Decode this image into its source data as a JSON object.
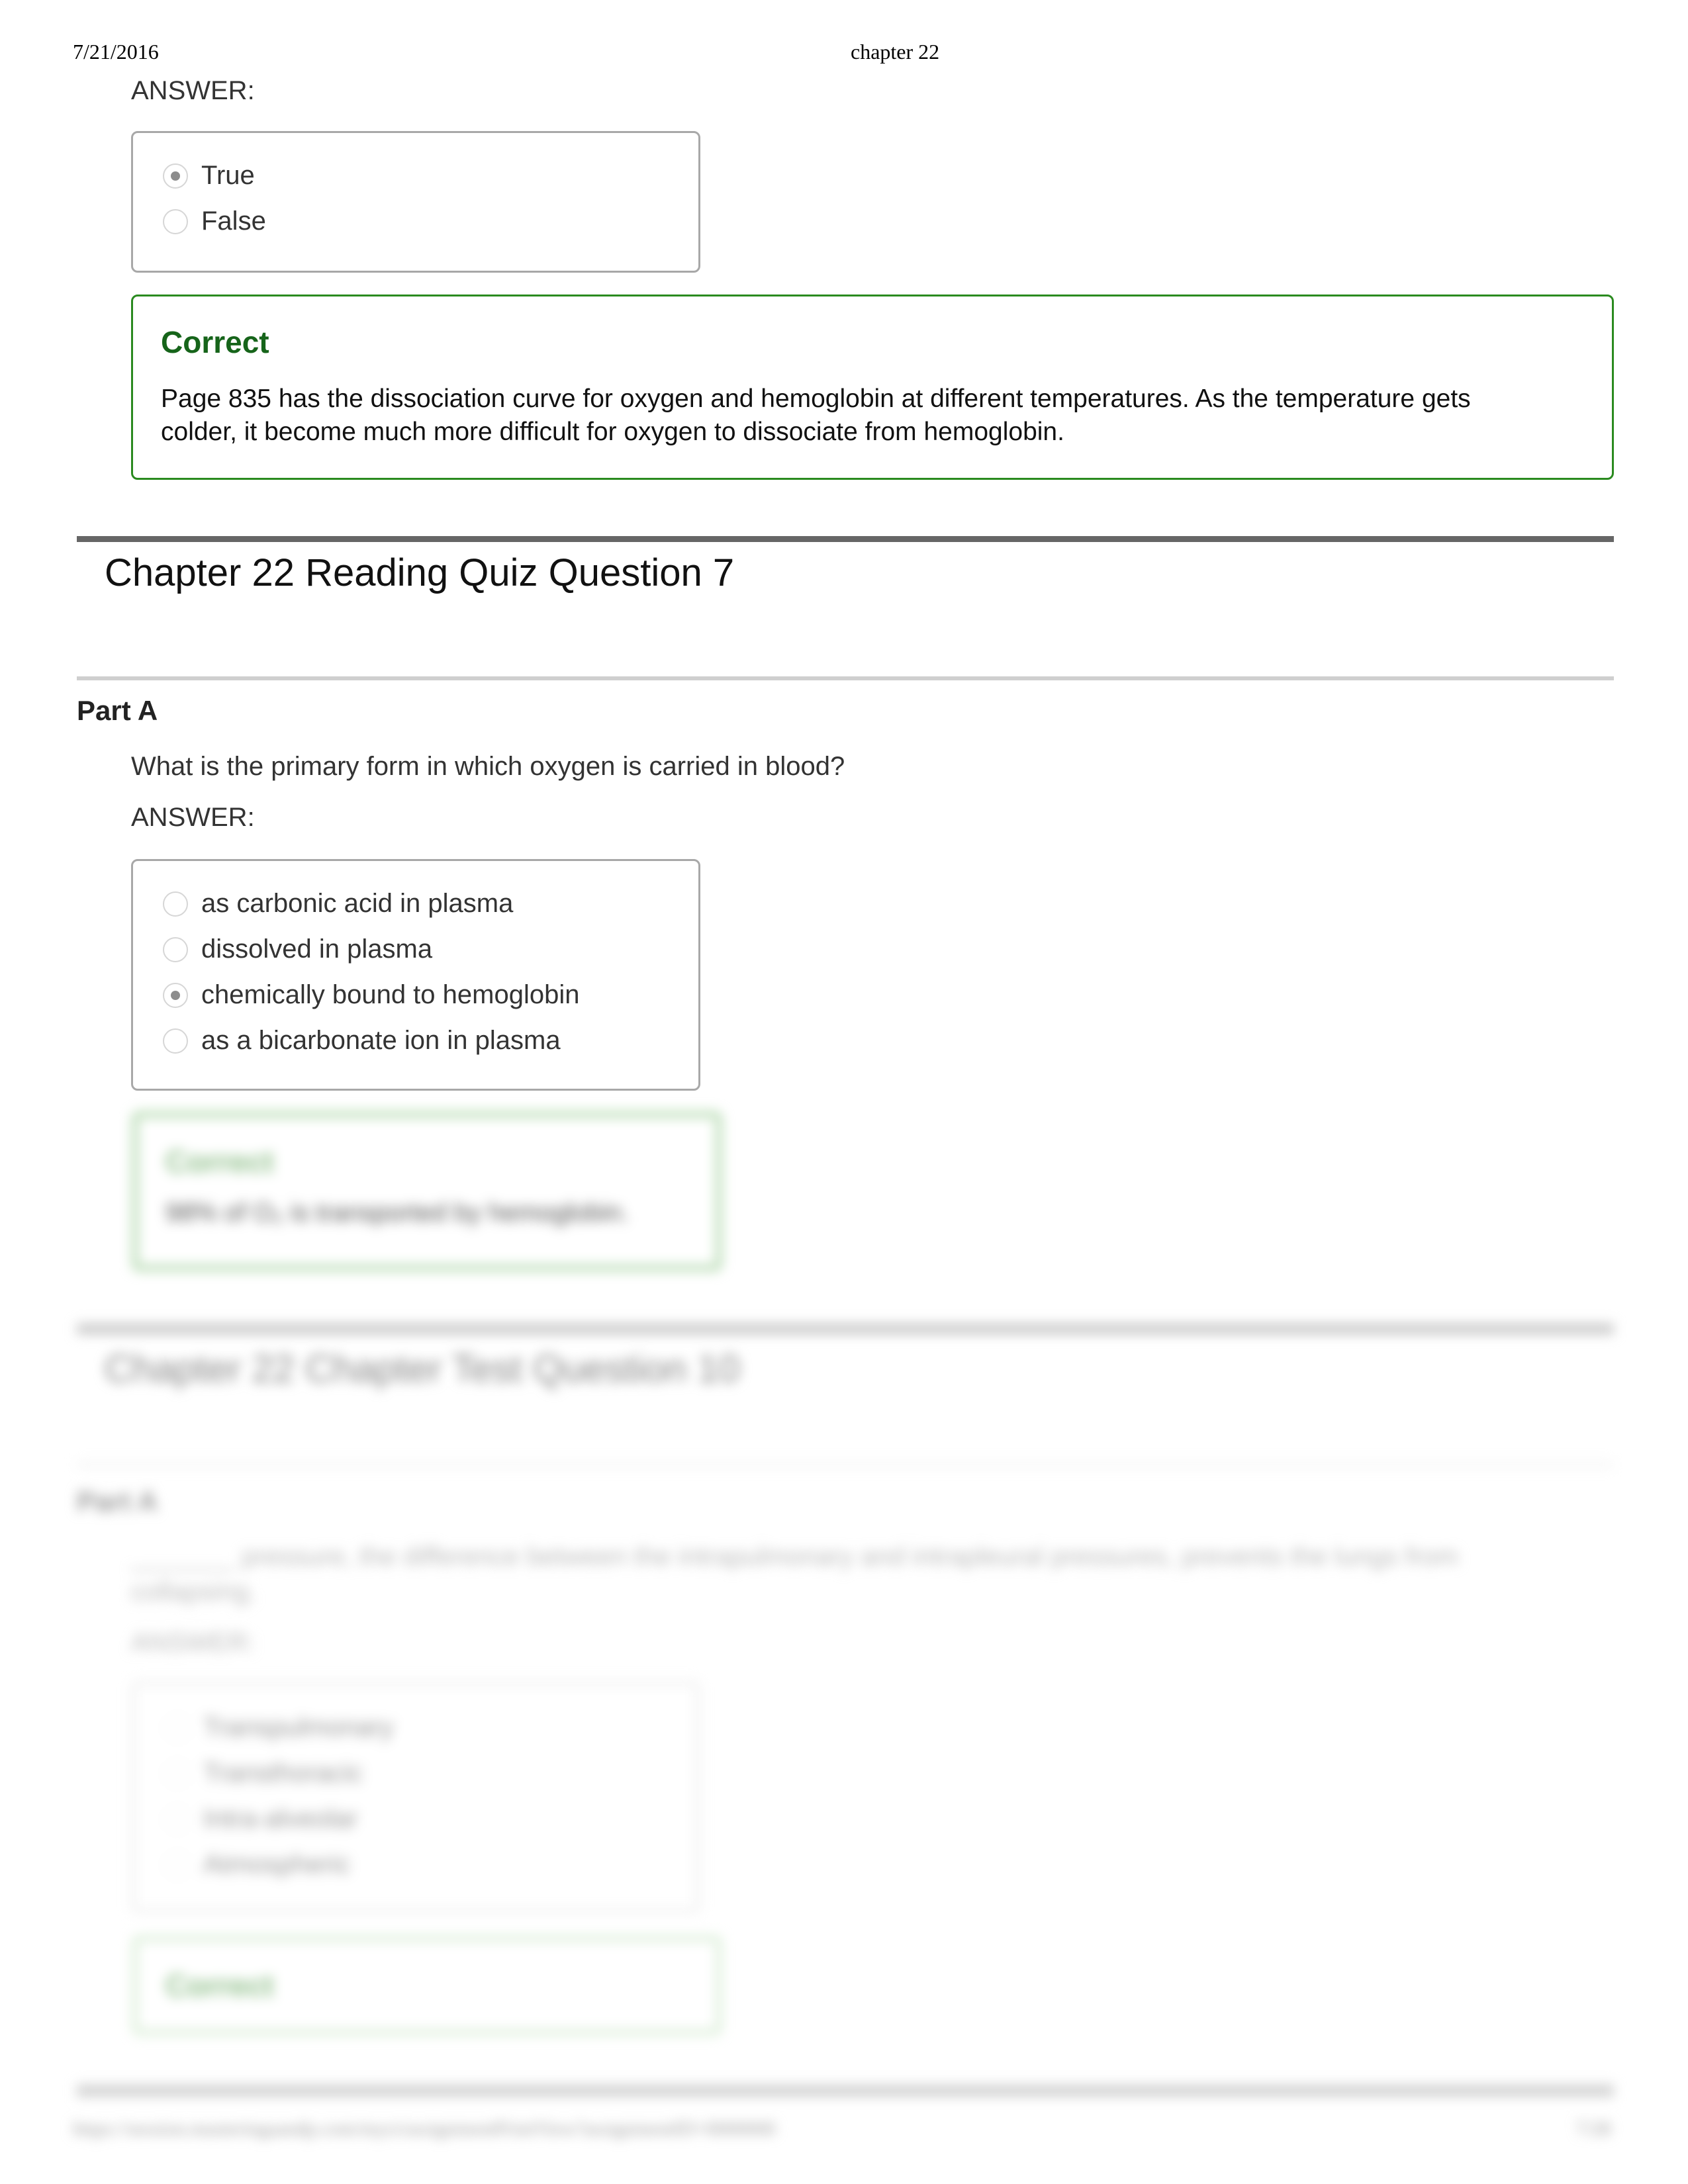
{
  "header": {
    "date": "7/21/2016",
    "title": "chapter 22"
  },
  "q6": {
    "answer_label": "ANSWER:",
    "options": [
      {
        "label": "True",
        "selected": true
      },
      {
        "label": "False",
        "selected": false
      }
    ],
    "feedback": {
      "status": "Correct",
      "text": "Page 835 has the dissociation curve for oxygen and hemoglobin at different temperatures. As the temperature gets colder, it become much more difficult for oxygen to dissociate from hemoglobin."
    }
  },
  "q7": {
    "title": "Chapter 22 Reading Quiz Question 7",
    "part": "Part A",
    "question": "What is the primary form in which oxygen is carried in blood?",
    "answer_label": "ANSWER:",
    "options": [
      {
        "label": "as carbonic acid in plasma",
        "selected": false
      },
      {
        "label": "dissolved in plasma",
        "selected": false
      },
      {
        "label": "chemically bound to hemoglobin",
        "selected": true
      },
      {
        "label": "as a bicarbonate ion in plasma",
        "selected": false
      }
    ],
    "feedback": {
      "status": "Correct",
      "text": "98% of O₂ is transported by hemoglobin."
    }
  },
  "q10": {
    "title": "Chapter 22 Chapter Test Question 10",
    "part": "Part A",
    "question_line1": "_______ pressure, the difference between the intrapulmonary and intrapleural pressures, prevents the lungs from",
    "question_line2": "collapsing.",
    "answer_label": "ANSWER:",
    "options": [
      {
        "label": "Transpulmonary",
        "selected": false
      },
      {
        "label": "Transthoracic",
        "selected": false
      },
      {
        "label": "Intra-alveolar",
        "selected": false
      },
      {
        "label": "Atmospheric",
        "selected": false
      }
    ],
    "feedback": {
      "status": "Correct"
    }
  },
  "footer": {
    "url": "https://session.masteringaandp.com/myct/assignmentPrintView?assignmentID=0000000",
    "page": "7/28"
  },
  "colors": {
    "correct_border": "#2a8a1f",
    "correct_title": "#16641a",
    "rule_dark": "#666666",
    "rule_light": "#cfcfcf"
  }
}
